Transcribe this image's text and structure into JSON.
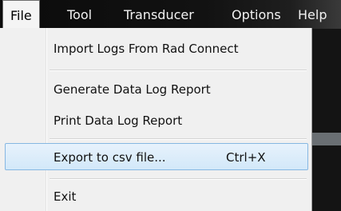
{
  "menubar": {
    "items": [
      {
        "label": "File"
      },
      {
        "label": "Tool"
      },
      {
        "label": "Transducer"
      },
      {
        "label": "Options"
      },
      {
        "label": "Help"
      }
    ]
  },
  "file_menu": {
    "items": [
      {
        "label": "Import Logs From Rad Connect"
      },
      {
        "label": "Generate Data Log Report"
      },
      {
        "label": "Print Data Log Report"
      },
      {
        "label": "Export to csv file...",
        "shortcut": "Ctrl+X",
        "highlighted": true
      },
      {
        "label": "Exit"
      }
    ]
  },
  "colors": {
    "highlight_bg": "#d9ebfa",
    "highlight_border": "#86b7e2",
    "menubar_bg": "#0b0b0b",
    "menu_bg": "#f0f0f0"
  }
}
